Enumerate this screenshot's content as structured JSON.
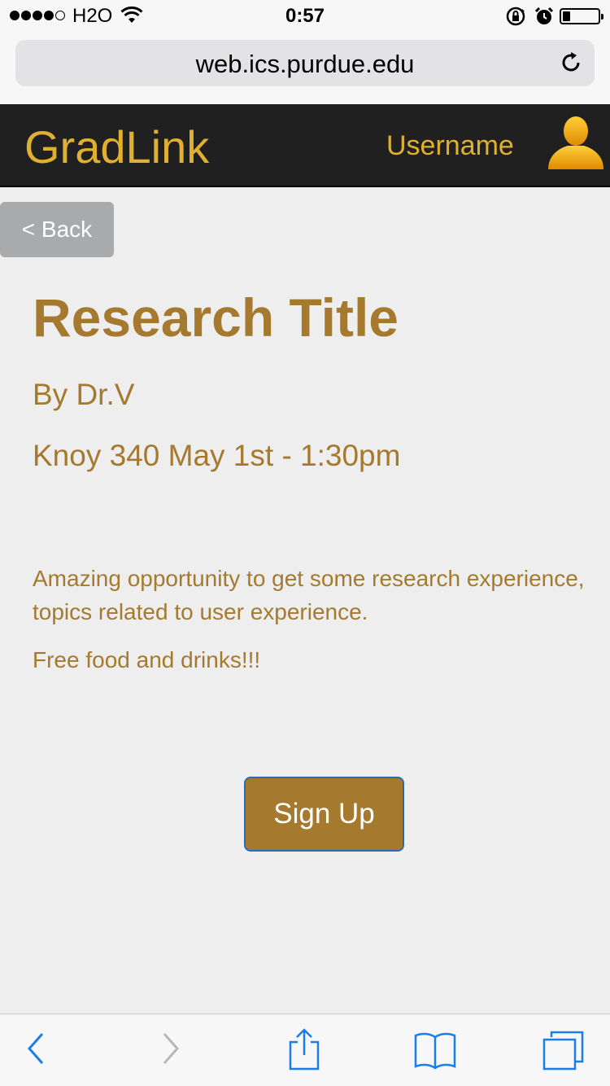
{
  "status_bar": {
    "carrier": "H2O",
    "time": "0:57",
    "battery_level": 0.22
  },
  "browser": {
    "url": "web.ics.purdue.edu",
    "icons": [
      "reload-icon",
      "back-arrow-icon",
      "forward-arrow-icon",
      "share-icon",
      "bookmarks-icon",
      "tabs-icon"
    ]
  },
  "header": {
    "brand": "GradLink",
    "username": "Username",
    "avatar_icon": "user-avatar-icon"
  },
  "nav": {
    "back_label": "< Back"
  },
  "event": {
    "title": "Research Title",
    "author": "By Dr.V",
    "details": "Knoy 340 May 1st - 1:30pm",
    "description": "Amazing opportunity to get some research experience, topics related to user experience.",
    "extra": "Free food and drinks!!!"
  },
  "actions": {
    "signup_label": "Sign Up"
  },
  "colors": {
    "accent_gold": "#a57a2e",
    "header_gold": "#e0b030",
    "header_bg": "#202020",
    "ios_blue": "#1a7ee6"
  }
}
